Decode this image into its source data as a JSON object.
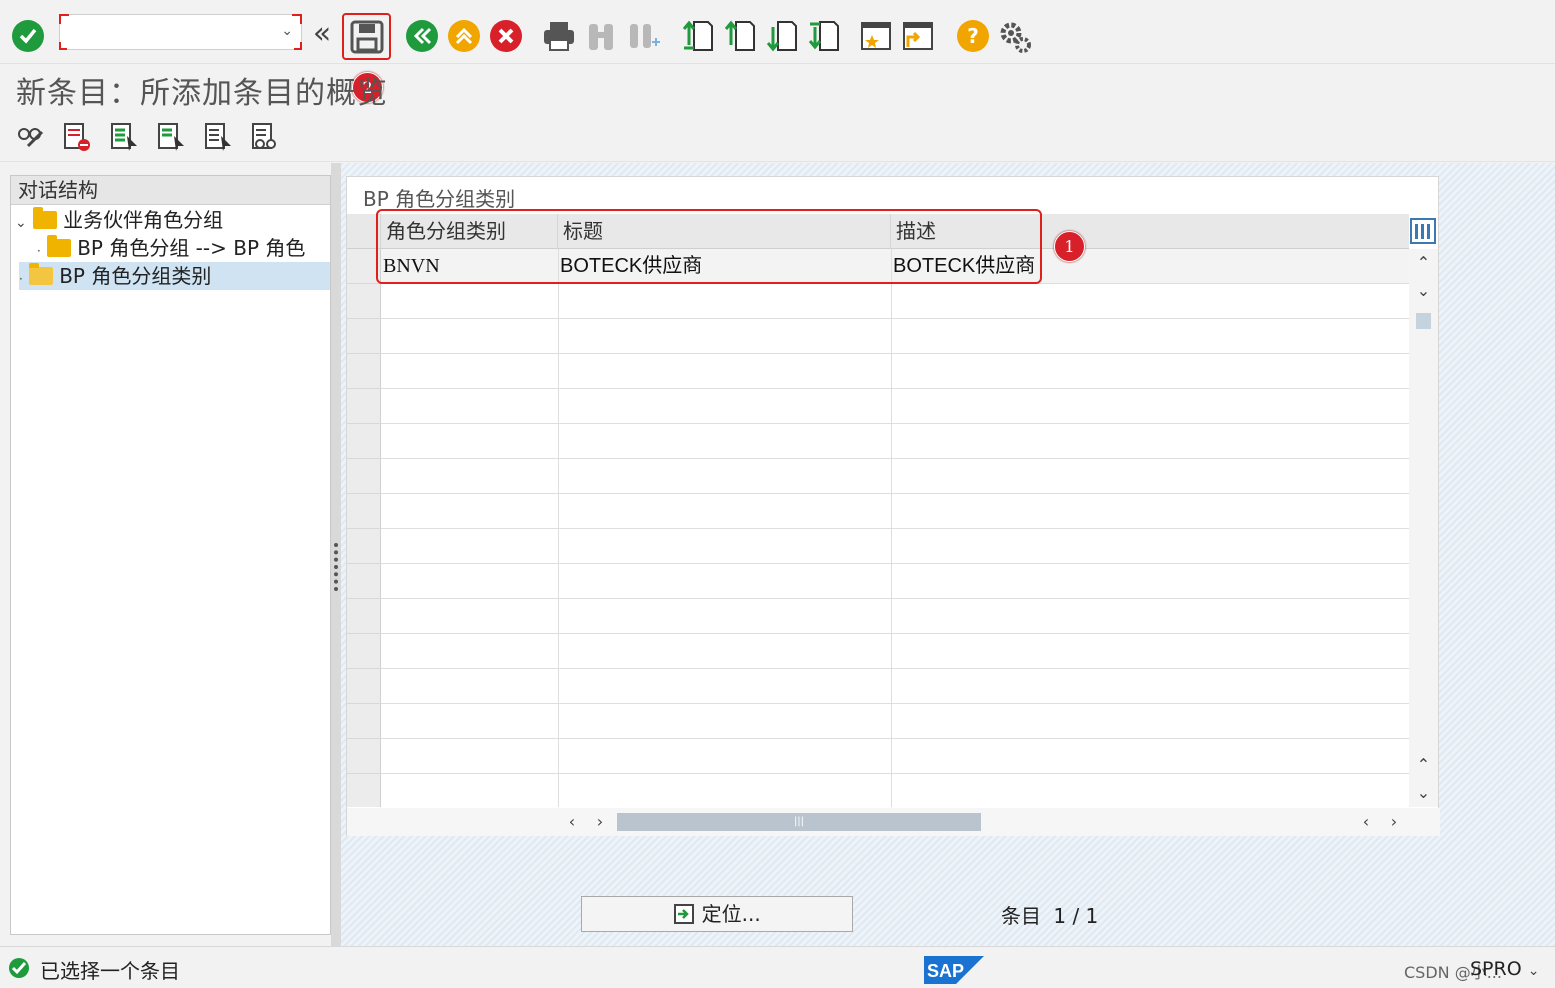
{
  "toolbar": {
    "command_value": "",
    "save_badge": "2",
    "help_label": "?"
  },
  "title": "新条目：所添加条目的概览",
  "tree": {
    "header": "对话结构",
    "items": [
      {
        "label": "业务伙伴角色分组"
      },
      {
        "label": "BP 角色分组 --> BP 角色"
      },
      {
        "label": "BP 角色分组类别"
      }
    ]
  },
  "panel": {
    "title": "BP 角色分组类别",
    "columns": [
      "角色分组类别",
      "标题",
      "描述"
    ],
    "rows": [
      {
        "category": "BNVN",
        "title": "BOTECK供应商",
        "description": "BOTECK供应商"
      }
    ],
    "annotation_badge": "1",
    "locate_button": "定位...",
    "entry_label": "条目",
    "entry_count": "1 / 1"
  },
  "status": {
    "message": "已选择一个条目",
    "watermark": "CSDN @小...",
    "system": "SPRO"
  },
  "colors": {
    "accent_red": "#e0201c",
    "ok_green": "#1f9a3c",
    "warn_orange": "#f0a500",
    "sap_blue": "#1a73d0"
  }
}
